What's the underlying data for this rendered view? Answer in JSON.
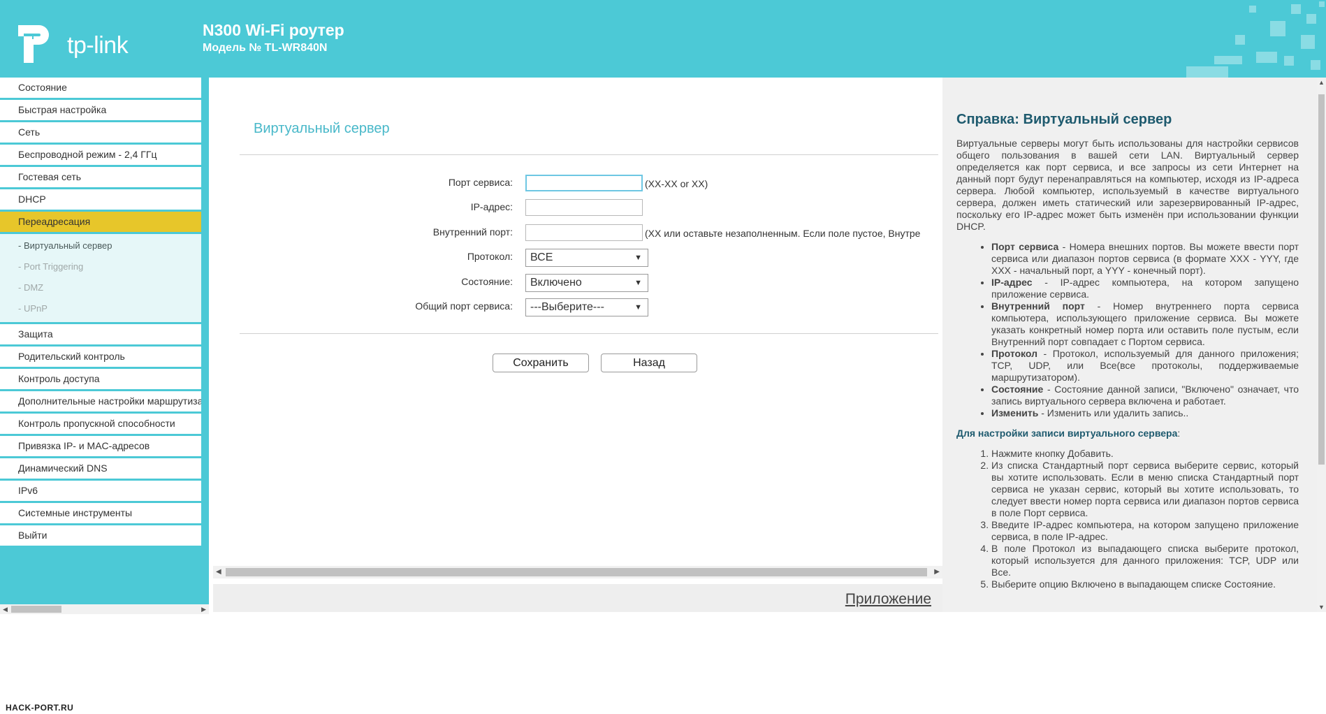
{
  "colors": {
    "brand": "#4cc9d6",
    "active_menu": "#e7c62a",
    "title": "#48b8c9",
    "help_title": "#1e5a6e"
  },
  "header": {
    "logo_text": "tp-link",
    "product_title": "N300 Wi-Fi роутер",
    "model": "Модель № TL-WR840N"
  },
  "sidebar": {
    "items": [
      "Состояние",
      "Быстрая настройка",
      "Сеть",
      "Беспроводной режим - 2,4 ГГц",
      "Гостевая сеть",
      "DHCP",
      "Переадресация",
      "Защита",
      "Родительский контроль",
      "Контроль доступа",
      "Дополнительные настройки маршрутизации",
      "Контроль пропускной способности",
      "Привязка IP- и MAC-адресов",
      "Динамический DNS",
      "IPv6",
      "Системные инструменты",
      "Выйти"
    ],
    "subitems": [
      "- Виртуальный сервер",
      "- Port Triggering",
      "- DMZ",
      "- UPnP"
    ]
  },
  "main": {
    "title": "Виртуальный сервер",
    "labels": {
      "service_port": "Порт сервиса:",
      "ip": "IP-адрес:",
      "internal_port": "Внутренний порт:",
      "protocol": "Протокол:",
      "status": "Состояние:",
      "common_port": "Общий порт сервиса:"
    },
    "hints": {
      "service_port": "(XX-XX or XX)",
      "internal_port": "(XX или оставьте незаполненным. Если поле пустое, Внутре"
    },
    "values": {
      "service_port": "",
      "ip": "",
      "internal_port": ""
    },
    "selects": {
      "protocol": "ВСЕ",
      "status": "Включено",
      "common_port": "---Выберите---"
    },
    "buttons": {
      "save": "Сохранить",
      "back": "Назад"
    },
    "app_link": "Приложение"
  },
  "help": {
    "title": "Справка: Виртуальный сервер",
    "intro": "Виртуальные серверы могут быть использованы для настройки сервисов общего пользования в вашей сети LAN. Виртуальный сервер определяется как порт сервиса, и все запросы из сети Интернет на данный порт будут перенаправляться на компьютер, исходя из IP-адреса сервера. Любой компьютер, используемый в качестве виртуального сервера, должен иметь статический или зарезервированный IP-адрес, поскольку его IP-адрес может быть изменён при использовании функции DHCP.",
    "bullets": [
      {
        "term": "Порт сервиса",
        "text": " - Номера внешних портов. Вы можете ввести порт сервиса или диапазон портов сервиса (в формате XXX - YYY, где XXX - начальный порт, а YYY - конечный порт)."
      },
      {
        "term": "IP-адрес",
        "text": " - IP-адрес компьютера, на котором запущено приложение сервиса."
      },
      {
        "term": "Внутренний порт",
        "text": " - Номер внутреннего порта сервиса компьютера, использующего приложение сервиса. Вы можете указать конкретный номер порта или оставить поле пустым, если Внутренний порт совпадает с Портом сервиса."
      },
      {
        "term": "Протокол",
        "text": " - Протокол, используемый для данного приложения; TCP, UDP, или Все(все протоколы, поддерживаемые маршрутизатором)."
      },
      {
        "term": "Состояние",
        "text": " - Состояние данной записи, \"Включено\" означает, что запись виртуального сервера включена и работает."
      },
      {
        "term": "Изменить",
        "text": " - Изменить или удалить запись.."
      }
    ],
    "subhead": "Для настройки записи виртуального сервера",
    "subhead_colon": ":",
    "steps": [
      "Нажмите кнопку Добавить.",
      "Из списка Стандартный порт сервиса выберите сервис, который вы хотите использовать. Если в меню списка Стандартный порт сервиса не указан сервис, который вы хотите использовать, то следует ввести номер порта сервиса или диапазон портов сервиса в поле Порт сервиса.",
      "Введите IP-адрес компьютера, на котором запущено приложение сервиса, в поле IP-адрес.",
      "В поле Протокол из выпадающего списка выберите протокол, который используется для данного приложения: TCP, UDP или Все.",
      "Выберите опцию Включено в выпадающем списке Состояние."
    ]
  },
  "watermark": "HACK-PORT.RU"
}
